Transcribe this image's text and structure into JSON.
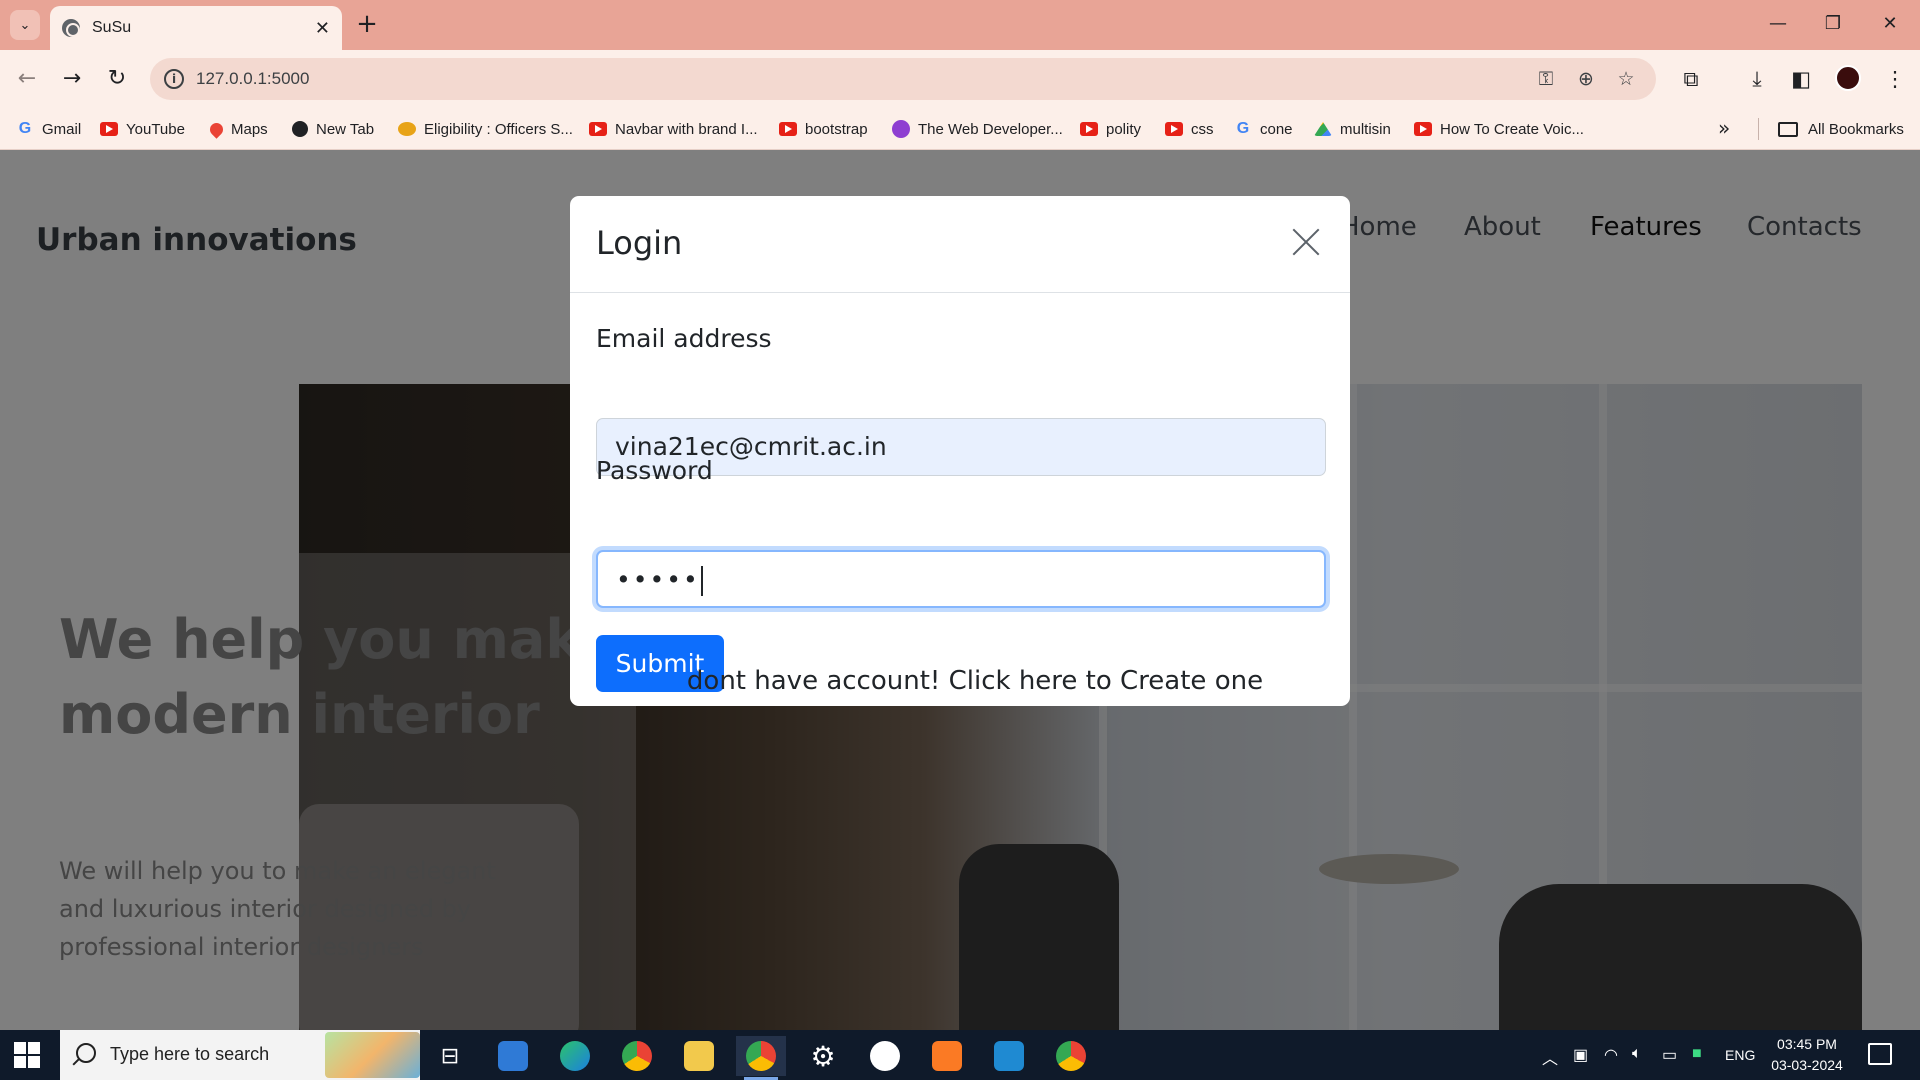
{
  "browser": {
    "tab_title": "SuSu",
    "url": "127.0.0.1:5000",
    "bookmarks": [
      {
        "label": "Gmail",
        "icon": "gmail-icon"
      },
      {
        "label": "YouTube",
        "icon": "youtube-icon"
      },
      {
        "label": "Maps",
        "icon": "maps-icon"
      },
      {
        "label": "New Tab",
        "icon": "globe-icon"
      },
      {
        "label": "Eligibility : Officers S...",
        "icon": "leaf-icon"
      },
      {
        "label": "Navbar with brand I...",
        "icon": "youtube-icon"
      },
      {
        "label": "bootstrap",
        "icon": "youtube-icon"
      },
      {
        "label": "The Web Developer...",
        "icon": "twd-icon"
      },
      {
        "label": "polity",
        "icon": "youtube-icon"
      },
      {
        "label": "css",
        "icon": "youtube-icon"
      },
      {
        "label": "cone",
        "icon": "google-icon"
      },
      {
        "label": "multisin",
        "icon": "drive-icon"
      },
      {
        "label": "How To Create Voic...",
        "icon": "youtube-icon"
      }
    ],
    "all_bookmarks": "All Bookmarks"
  },
  "site": {
    "brand": "Urban innovations",
    "nav": [
      "Home",
      "About",
      "Features",
      "Contacts"
    ],
    "hero_title": "We help you make modern interior",
    "hero_subtitle": "We will help you to make an elegant and luxurious interior designed by professional interior designers"
  },
  "modal": {
    "title": "Login",
    "email_label": "Email address",
    "email_value": "vina21ec@cmrit.ac.in",
    "password_label": "Password",
    "password_value": "•••••",
    "submit_label": "Submit",
    "signup_text": "dont have account! Click here to Create one"
  },
  "taskbar": {
    "search_placeholder": "Type here to search",
    "language": "ENG",
    "time": "03:45 PM",
    "date": "03-03-2024"
  },
  "colors": {
    "tabstrip": "#e8a496",
    "primary_button": "#0d6efd",
    "input_focus_border": "#86b7fe",
    "autofill_bg": "#e8f0fe"
  }
}
